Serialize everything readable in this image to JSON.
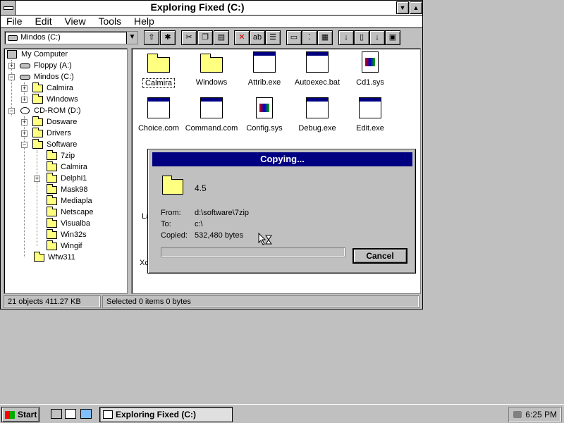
{
  "window": {
    "title": "Exploring Fixed (C:)"
  },
  "menu": {
    "file": "File",
    "edit": "Edit",
    "view": "View",
    "tools": "Tools",
    "help": "Help"
  },
  "toolbar": {
    "drive": "Mindos (C:)"
  },
  "tree": [
    {
      "label": "My Computer",
      "icon": "computer-icon"
    },
    {
      "label": "Floppy (A:)",
      "icon": "floppy-drive-icon"
    },
    {
      "label": "Mindos (C:)",
      "icon": "hard-drive-icon"
    },
    {
      "label": "Calmira",
      "icon": "folder-icon"
    },
    {
      "label": "Windows",
      "icon": "folder-icon"
    },
    {
      "label": "CD-ROM (D:)",
      "icon": "cdrom-icon"
    },
    {
      "label": "Dosware",
      "icon": "folder-icon"
    },
    {
      "label": "Drivers",
      "icon": "folder-icon"
    },
    {
      "label": "Software",
      "icon": "open-folder-icon"
    },
    {
      "label": "7zip",
      "icon": "folder-icon"
    },
    {
      "label": "Calmira",
      "icon": "folder-icon"
    },
    {
      "label": "Delphi1",
      "icon": "folder-icon"
    },
    {
      "label": "Mask98",
      "icon": "folder-icon"
    },
    {
      "label": "Mediapla",
      "icon": "folder-icon"
    },
    {
      "label": "Netscape",
      "icon": "folder-icon"
    },
    {
      "label": "Visualba",
      "icon": "folder-icon"
    },
    {
      "label": "Win32s",
      "icon": "folder-icon"
    },
    {
      "label": "Wingif",
      "icon": "folder-icon"
    },
    {
      "label": "Wfw311",
      "icon": "folder-icon"
    }
  ],
  "files": [
    {
      "label": "Calmira",
      "icon": "folder-icon"
    },
    {
      "label": "Windows",
      "icon": "folder-icon"
    },
    {
      "label": "Attrib.exe",
      "icon": "program-icon"
    },
    {
      "label": "Autoexec.bat",
      "icon": "program-icon"
    },
    {
      "label": "Cd1.sys",
      "icon": "system-file-icon"
    },
    {
      "label": "Choice.com",
      "icon": "program-icon"
    },
    {
      "label": "Command.com",
      "icon": "program-icon"
    },
    {
      "label": "Config.sys",
      "icon": "system-file-icon"
    },
    {
      "label": "Debug.exe",
      "icon": "program-icon"
    },
    {
      "label": "Edit.exe",
      "icon": "program-icon"
    }
  ],
  "partial_labels": {
    "la": "La",
    "xc": "Xc"
  },
  "status": {
    "objects": "21 objects  411.27 KB",
    "selected": "Selected 0 items  0 bytes"
  },
  "dialog": {
    "title": "Copying...",
    "item": "4.5",
    "from_label": "From:",
    "from_value": "d:\\software\\7zip",
    "to_label": "To:",
    "to_value": "c:\\",
    "copied_label": "Copied:",
    "copied_value": "532,480 bytes",
    "progress": 0,
    "cancel": "Cancel"
  },
  "taskbar": {
    "start": "Start",
    "task": "Exploring Fixed (C:)",
    "time": "6:25 PM"
  },
  "colors": {
    "desktop": "#c0c0c0",
    "title_active": "#000080",
    "folder": "#ffff80"
  }
}
